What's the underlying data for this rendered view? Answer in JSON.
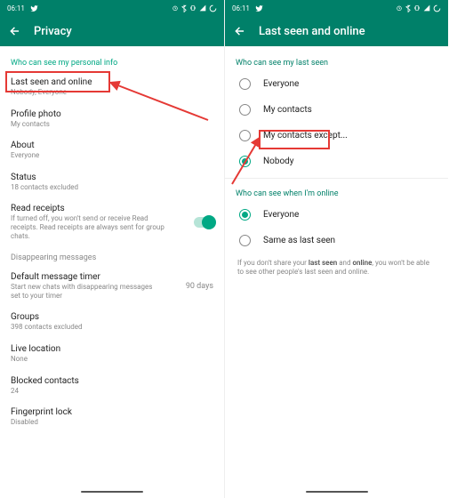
{
  "status": {
    "time": "06:11",
    "iconsLeft": "twitter",
    "iconsRight": "alarm bt vibe wifi signal loading"
  },
  "left": {
    "title": "Privacy",
    "section1": "Who can see my personal info",
    "rows": [
      {
        "t": "Last seen and online",
        "s": "Nobody, Everyone"
      },
      {
        "t": "Profile photo",
        "s": "My contacts"
      },
      {
        "t": "About",
        "s": "Everyone"
      },
      {
        "t": "Status",
        "s": "18 contacts excluded"
      }
    ],
    "readReceipts": {
      "t": "Read receipts",
      "s": "If turned off, you won't send or receive Read receipts. Read receipts are always sent for group chats."
    },
    "section2": "Disappearing messages",
    "dmt": {
      "t": "Default message timer",
      "s": "Start new chats with disappearing messages set to your timer",
      "r": "90 days"
    },
    "rows2": [
      {
        "t": "Groups",
        "s": "398 contacts excluded"
      },
      {
        "t": "Live location",
        "s": "None"
      },
      {
        "t": "Blocked contacts",
        "s": "24"
      },
      {
        "t": "Fingerprint lock",
        "s": "Disabled"
      }
    ]
  },
  "right": {
    "title": "Last seen and online",
    "section1": "Who can see my last seen",
    "opts1": [
      "Everyone",
      "My contacts",
      "My contacts except...",
      "Nobody"
    ],
    "selected1": 3,
    "section2": "Who can see when I'm online",
    "opts2": [
      "Everyone",
      "Same as last seen"
    ],
    "selected2": 0,
    "note1": "If you don't share your ",
    "noteB1": "last seen",
    "note2": " and ",
    "noteB2": "online",
    "note3": ", you won't be able to see other people's last seen and online."
  }
}
